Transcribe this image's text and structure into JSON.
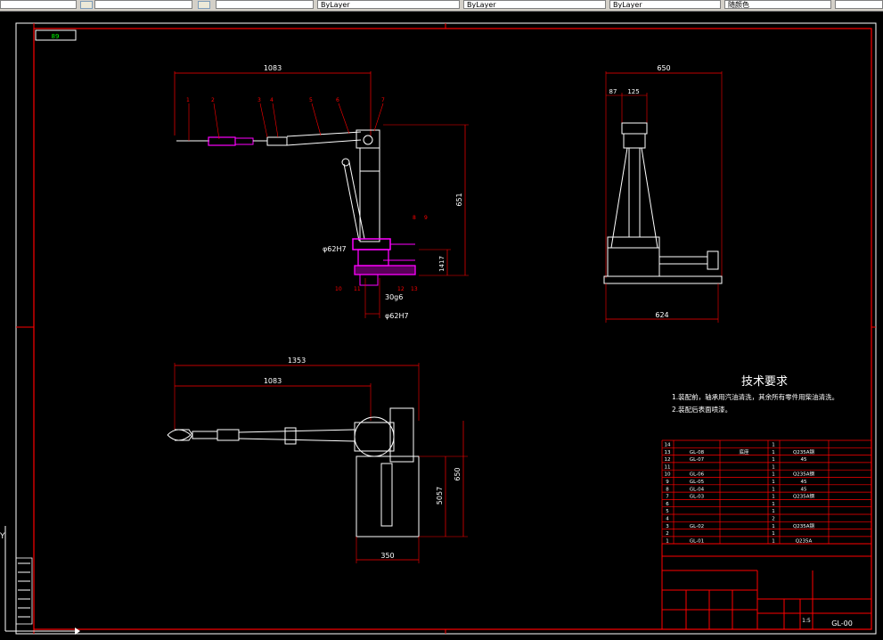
{
  "toolbar": {
    "fields": [
      "",
      "",
      "",
      "",
      "",
      "",
      ""
    ],
    "combo_label": "",
    "layer_field": "ByLayer",
    "linetype_field": "ByLayer",
    "lineweight_field": "ByLayer",
    "plotstyle_field": "随颜色"
  },
  "drawing": {
    "badge": "89",
    "notes_title": "技术要求",
    "notes": [
      "1.装配前，轴承用汽油清洗，其余所有零件用柴油清洗。",
      "2.装配后表面喷漆。"
    ],
    "dims": {
      "top_width": "1083",
      "top_height": "651",
      "base_height": "1417",
      "bore_1": "φ62H7",
      "bore_2": "φ62H7",
      "shaft": "30g6",
      "side_width": "650",
      "side_87": "87",
      "side_125": "125",
      "side_base": "624",
      "plan_1353": "1353",
      "plan_1083": "1083",
      "plan_5057": "5057",
      "plan_650": "650",
      "plan_350": "350"
    },
    "balloons": [
      "1",
      "2",
      "3",
      "4",
      "5",
      "6",
      "7",
      "8",
      "9",
      "10",
      "11",
      "12",
      "13"
    ],
    "bom": [
      {
        "no": "14",
        "code": "",
        "name": "",
        "qty": "1",
        "mat": ""
      },
      {
        "no": "13",
        "code": "GL-08",
        "name": "底座",
        "qty": "1",
        "mat": "Q235A钢"
      },
      {
        "no": "12",
        "code": "GL-07",
        "name": "",
        "qty": "1",
        "mat": "45"
      },
      {
        "no": "11",
        "code": "",
        "name": "",
        "qty": "1",
        "mat": ""
      },
      {
        "no": "10",
        "code": "GL-06",
        "name": "",
        "qty": "1",
        "mat": "Q235A钢"
      },
      {
        "no": "9",
        "code": "GL-05",
        "name": "",
        "qty": "1",
        "mat": "45"
      },
      {
        "no": "8",
        "code": "GL-04",
        "name": "",
        "qty": "1",
        "mat": "45"
      },
      {
        "no": "7",
        "code": "GL-03",
        "name": "",
        "qty": "1",
        "mat": "Q235A钢"
      },
      {
        "no": "6",
        "code": "",
        "name": "",
        "qty": "1",
        "mat": ""
      },
      {
        "no": "5",
        "code": "",
        "name": "",
        "qty": "1",
        "mat": ""
      },
      {
        "no": "4",
        "code": "",
        "name": "",
        "qty": "2",
        "mat": ""
      },
      {
        "no": "3",
        "code": "GL-02",
        "name": "",
        "qty": "1",
        "mat": "Q235A钢"
      },
      {
        "no": "2",
        "code": "",
        "name": "",
        "qty": "1",
        "mat": ""
      },
      {
        "no": "1",
        "code": "GL-01",
        "name": "",
        "qty": "1",
        "mat": "Q235A"
      }
    ],
    "title_block": {
      "assembly_name": "",
      "scale": "1:5",
      "drawing_no": "GL-00",
      "school": ""
    },
    "ucs_label": "Y"
  },
  "colors": {
    "frame": "#ff0000",
    "outline": "#ffffff",
    "part": "#ff00ff",
    "background": "#000000"
  }
}
